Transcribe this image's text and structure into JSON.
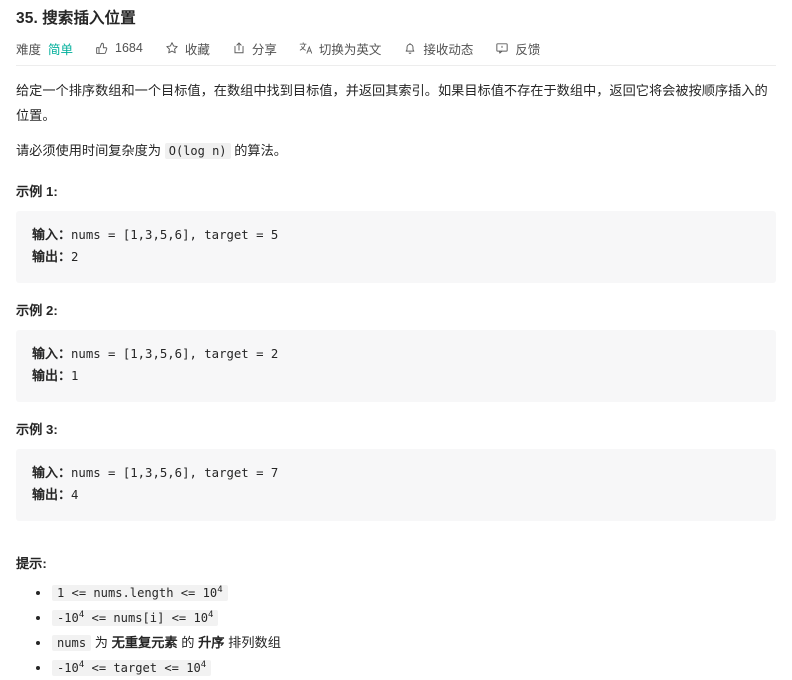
{
  "problem": {
    "title": "35. 搜索插入位置",
    "difficulty_label": "难度",
    "difficulty_value": "简单",
    "difficulty_color": "#00af9b",
    "likes": "1684",
    "favorite_label": "收藏",
    "share_label": "分享",
    "translate_label": "切换为英文",
    "subscribe_label": "接收动态",
    "feedback_label": "反馈"
  },
  "description": {
    "paragraph1": "给定一个排序数组和一个目标值，在数组中找到目标值，并返回其索引。如果目标值不存在于数组中，返回它将会被按顺序插入的位置。",
    "paragraph2_prefix": "请必须使用时间复杂度为 ",
    "paragraph2_code": "O(log n)",
    "paragraph2_suffix": " 的算法。"
  },
  "examples": [
    {
      "heading": "示例 1:",
      "input_label": "输入：",
      "input_value": "nums = [1,3,5,6], target = 5",
      "output_label": "输出：",
      "output_value": "2"
    },
    {
      "heading": "示例 2:",
      "input_label": "输入：",
      "input_value": "nums = [1,3,5,6], target = 2",
      "output_label": "输出：",
      "output_value": "1"
    },
    {
      "heading": "示例 3:",
      "input_label": "输入：",
      "input_value": "nums = [1,3,5,6], target = 7",
      "output_label": "输出：",
      "output_value": "4"
    }
  ],
  "hints": {
    "heading": "提示:",
    "items": [
      {
        "kind": "code",
        "pre": "1 <= nums.length <= 10",
        "sup": "4",
        "post": ""
      },
      {
        "kind": "code",
        "pre": "-10",
        "sup": "4",
        "mid": " <= nums[i] <= 10",
        "sup2": "4",
        "post": ""
      },
      {
        "kind": "mixed",
        "code": "nums",
        "t1": " 为 ",
        "b1": "无重复元素",
        "t2": " 的 ",
        "b2": "升序",
        "t3": " 排列数组"
      },
      {
        "kind": "code",
        "pre": "-10",
        "sup": "4",
        "mid": " <= target <= 10",
        "sup2": "4",
        "post": ""
      }
    ]
  }
}
